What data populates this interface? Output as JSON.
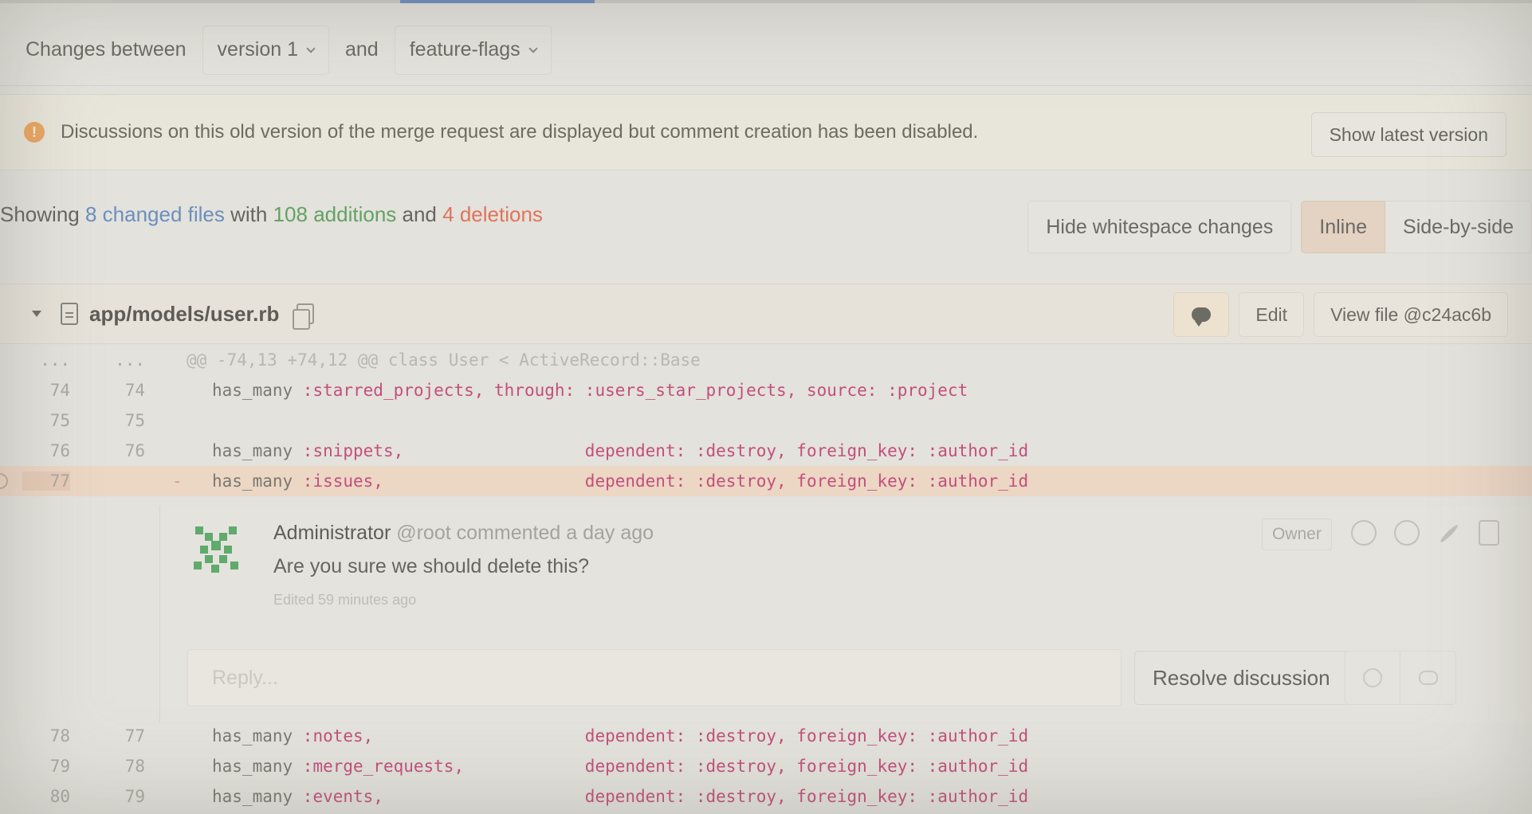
{
  "compare": {
    "label": "Changes between",
    "from_version": "version 1",
    "connector": "and",
    "to_version": "feature-flags"
  },
  "warning": {
    "icon": "warning-icon",
    "message": "Discussions on this old version of the merge request are displayed but comment creation has been disabled.",
    "button": "Show latest version"
  },
  "summary": {
    "prefix": "Showing",
    "files": "8 changed files",
    "with": "with",
    "additions": "108 additions",
    "and": "and",
    "deletions": "4 deletions"
  },
  "view_options": {
    "whitespace": "Hide whitespace changes",
    "inline": "Inline",
    "side_by_side": "Side-by-side"
  },
  "file": {
    "path": "app/models/user.rb",
    "edit": "Edit",
    "view_file": "View file @c24ac6b"
  },
  "diff": {
    "hunk": {
      "old": "...",
      "new": "...",
      "text": "@@ -74,13 +74,12 @@ class User < ActiveRecord::Base"
    },
    "lines_before": [
      {
        "old": "74",
        "new": "74",
        "kw": "has_many ",
        "sym": ":starred_projects, through: :users_star_projects, source: :project"
      },
      {
        "old": "75",
        "new": "75",
        "kw": "",
        "sym": ""
      },
      {
        "old": "76",
        "new": "76",
        "kw": "has_many ",
        "sym": ":snippets,                  dependent: :destroy, foreign_key: :author_id"
      }
    ],
    "deleted": {
      "old": "77",
      "new": "",
      "marker": "-",
      "kw": "has_many ",
      "sym": ":issues,                    dependent: :destroy, foreign_key: :author_id"
    },
    "lines_after": [
      {
        "old": "78",
        "new": "77",
        "kw": "has_many ",
        "sym": ":notes,                     dependent: :destroy, foreign_key: :author_id"
      },
      {
        "old": "79",
        "new": "78",
        "kw": "has_many ",
        "sym": ":merge_requests,            dependent: :destroy, foreign_key: :author_id"
      },
      {
        "old": "80",
        "new": "79",
        "kw": "has_many ",
        "sym": ":events,                    dependent: :destroy, foreign_key: :author_id"
      }
    ]
  },
  "note": {
    "author": "Administrator",
    "handle": "@root",
    "action": "commented",
    "time": "a day ago",
    "role": "Owner",
    "body": "Are you sure we should delete this?",
    "edited": "Edited 59 minutes ago",
    "reply_placeholder": "Reply...",
    "resolve": "Resolve discussion"
  },
  "colors": {
    "files": "#6b8fbe",
    "additions": "#62a263",
    "deletions": "#e2735a",
    "symbol": "#c34f7d",
    "deleted_bg": "#ecd6c4"
  }
}
